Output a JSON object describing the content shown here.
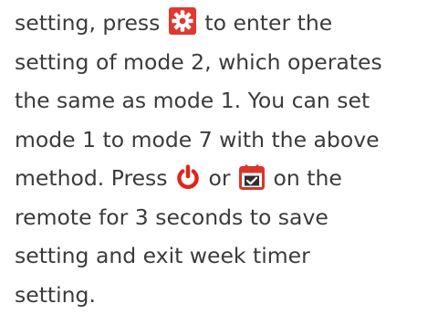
{
  "document": {
    "line1": {
      "pre": "setting, press",
      "post": "to enter the"
    },
    "line2": "setting of mode 2, which operates",
    "line3": "the same as mode 1. You can set",
    "line4": "mode 1 to mode 7 with the above",
    "line5": {
      "pre": "method. Press",
      "mid": "or",
      "post": "on the"
    },
    "line6": "remote for 3 seconds to save",
    "line7": "setting and exit week timer",
    "line8": "setting."
  },
  "icons": {
    "settings": {
      "name": "gear-icon",
      "color": "#e0382f"
    },
    "power": {
      "name": "power-icon",
      "color": "#e0251b"
    },
    "calendar": {
      "name": "calendar-check-icon",
      "color": "#d9352b"
    }
  },
  "colors": {
    "text": "#3b3b3b"
  }
}
